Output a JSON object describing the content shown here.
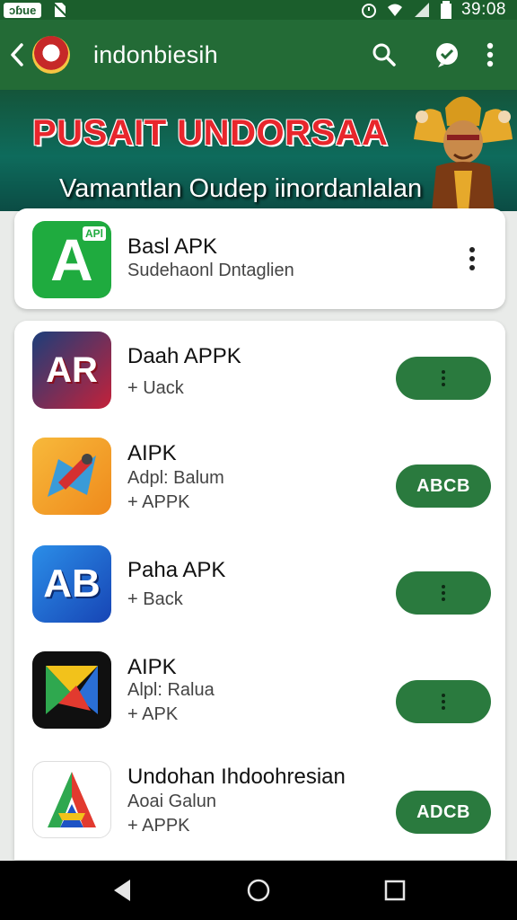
{
  "status_bar": {
    "carrier": "ɔɓue",
    "time": "39:08"
  },
  "app_bar": {
    "title": "indonbiesih"
  },
  "banner": {
    "title": "PUSAIT UNDORSAA",
    "subtitle": "Vamantlan Oudep iinordanlalan"
  },
  "featured": {
    "name": "Basl APK",
    "subtitle": "Sudehaonl Dntaglien",
    "icon_letter": "A",
    "icon_badge": "APl"
  },
  "apps": [
    {
      "name": "Daah APPK",
      "line1": "+ Uack",
      "line2": "",
      "icon": "AR",
      "button": ""
    },
    {
      "name": "AIPK",
      "line1": "Adpl: Balum",
      "line2": "+ APPK",
      "icon": "",
      "button": "ABCB"
    },
    {
      "name": "Paha APK",
      "line1": "+ Back",
      "line2": "",
      "icon": "AB",
      "button": ""
    },
    {
      "name": "AIPK",
      "line1": "Alpl: Ralua",
      "line2": "+ APK",
      "icon": "",
      "button": ""
    },
    {
      "name": "Undohan Ihdoohresian",
      "line1": "Aoai Galun",
      "line2": "+ APPK",
      "icon": "",
      "button": "ADCB"
    }
  ],
  "colors": {
    "app_bar": "#236b36",
    "status_bar": "#1b5e2c",
    "button": "#2a7a3e",
    "banner_title": "#e8262c"
  },
  "icons": [
    "back-icon",
    "search-icon",
    "chat-icon",
    "overflow-menu-icon",
    "nav-back-icon",
    "nav-home-icon",
    "nav-recents-icon"
  ]
}
